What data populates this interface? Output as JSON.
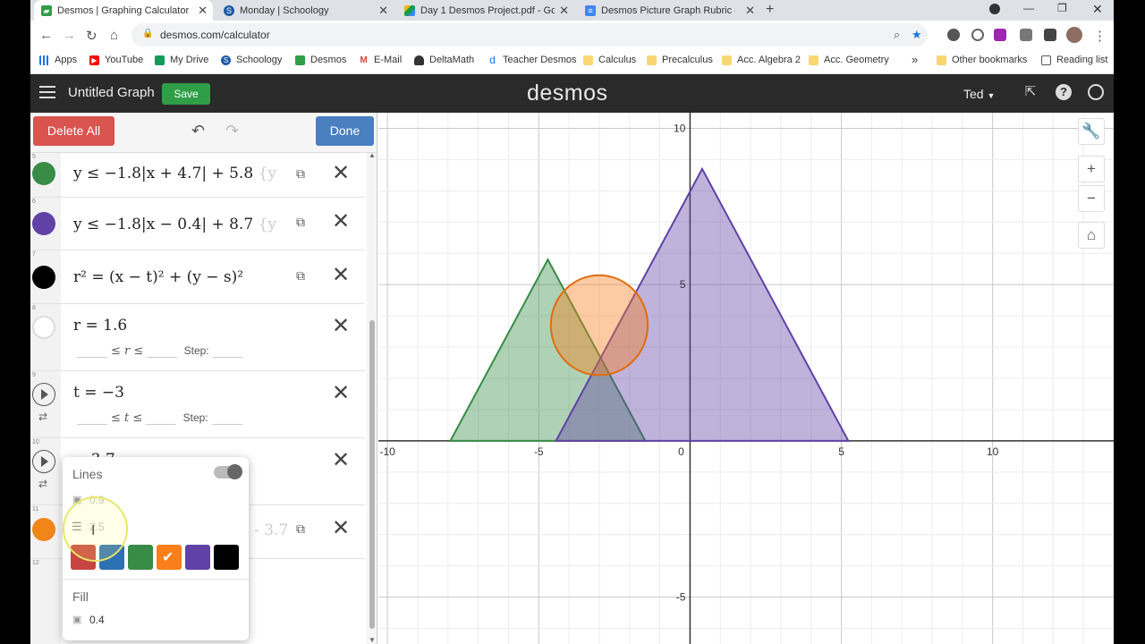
{
  "browser": {
    "tabs": [
      {
        "title": "Desmos | Graphing Calculator",
        "favicon": "desmos-favicon",
        "active": true
      },
      {
        "title": "Monday | Schoology",
        "favicon": "schoology-favicon"
      },
      {
        "title": "Day 1 Desmos Project.pdf - Goo",
        "favicon": "drive-favicon"
      },
      {
        "title": "Desmos Picture Graph Rubric (4",
        "favicon": "docs-favicon"
      }
    ],
    "url": "desmos.com/calculator",
    "bookmarks": [
      "Apps",
      "YouTube",
      "My Drive",
      "Schoology",
      "Desmos",
      "E-Mail",
      "DeltaMath",
      "Teacher Desmos",
      "Calculus",
      "Precalculus",
      "Acc. Algebra 2",
      "Acc. Geometry"
    ],
    "bookmarks_overflow": "»",
    "other_bookmarks": "Other bookmarks",
    "reading_list": "Reading list"
  },
  "desmos": {
    "graph_title": "Untitled Graph",
    "save_label": "Save",
    "logo": "desmos",
    "user": "Ted",
    "delete_all": "Delete All",
    "done": "Done"
  },
  "expressions": {
    "e5": {
      "num": "5",
      "color": "#388c46",
      "latex": "y ≤ −1.8|x + 4.7| + 5.8",
      "tail": "{y"
    },
    "e6": {
      "num": "6",
      "color": "#6042a6",
      "latex": "y ≤ −1.8|x − 0.4| + 8.7",
      "tail": "{y"
    },
    "e7": {
      "num": "7",
      "color": "#000000",
      "latex": "r² = (x − t)² + (y − s)²"
    },
    "e8": {
      "num": "8",
      "latex": "r = 1.6",
      "min_op": "≤ r ≤",
      "step": "Step:"
    },
    "e9": {
      "num": "9",
      "latex": "t = −3",
      "min_op": "≤ t ≤",
      "step": "Step:"
    },
    "e10": {
      "num": "10",
      "latex": "= 3.7"
    },
    "e11": {
      "num": "11",
      "color": "#f0851a",
      "tail": "- 3.7"
    },
    "e12": {
      "num": "12"
    }
  },
  "style_popup": {
    "lines_label": "Lines",
    "lines_opacity": "0.9",
    "lines_width": "2.5",
    "colors": [
      "#c74440",
      "#2d70b3",
      "#388c46",
      "#fa7e19",
      "#6042a6",
      "#000000"
    ],
    "selected_color": "#fa7e19",
    "fill_label": "Fill",
    "fill_opacity": "0.4"
  },
  "graph": {
    "x_ticks": [
      "-10",
      "-5",
      "0",
      "5",
      "10"
    ],
    "y_ticks": [
      "10",
      "5",
      "-5"
    ],
    "shapes": {
      "green_triangle": {
        "color": "#388c46",
        "inequality": "y ≤ −1.8|x + 4.7| + 5.8",
        "fill_opacity": 0.4
      },
      "purple_triangle": {
        "color": "#6042a6",
        "inequality": "y ≤ −1.8|x − 0.4| + 8.7",
        "fill_opacity": 0.4
      },
      "orange_circle": {
        "color": "#fa7e19",
        "center": [
          -3,
          3.7
        ],
        "radius": 1.6,
        "fill_opacity": 0.4
      }
    }
  },
  "chart_data": {
    "type": "scatter",
    "xlim": [
      -10.3,
      14
    ],
    "ylim": [
      -6.5,
      10.5
    ],
    "grid": true,
    "x_ticks": [
      -10,
      -5,
      0,
      5,
      10
    ],
    "y_ticks": [
      10,
      5,
      -5
    ],
    "series": [
      {
        "values": [
          [
            -7.92,
            0
          ],
          [
            -4.7,
            5.8
          ],
          [
            -1.48,
            0
          ]
        ]
      },
      {
        "values": [
          [
            -4.43,
            0
          ],
          [
            0.4,
            8.7
          ],
          [
            5.23,
            0
          ]
        ]
      }
    ],
    "circle": {
      "center": [
        -3,
        3.7
      ],
      "radius": 1.6
    }
  }
}
